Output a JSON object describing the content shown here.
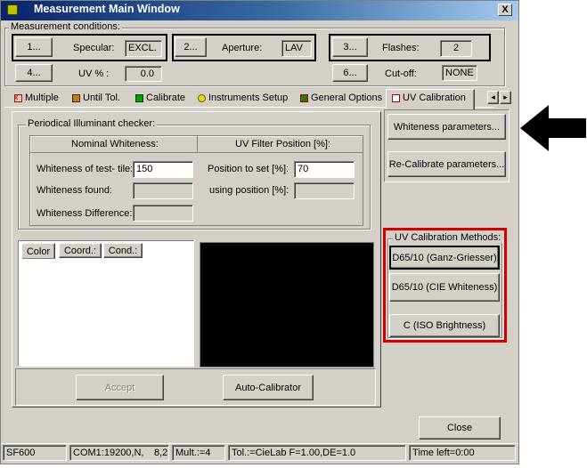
{
  "window": {
    "title": "Measurement Main Window",
    "close_glyph": "X"
  },
  "conditions": {
    "group_label": "Measurement conditions:",
    "btn1": "1...",
    "specular_label": "Specular:",
    "specular_value": "EXCL.",
    "btn2": "2...",
    "aperture_label": "Aperture:",
    "aperture_value": "LAV",
    "btn3": "3...",
    "flashes_label": "Flashes:",
    "flashes_value": "2",
    "btn4": "4...",
    "uv_label": "UV % :",
    "uv_value": "0.0",
    "btn6": "6...",
    "cutoff_label": "Cut-off:",
    "cutoff_value": "NONE"
  },
  "tabs": [
    {
      "label": "Multiple",
      "icon": "multiple-icon"
    },
    {
      "label": "Until Tol.",
      "icon": "until-tol-icon"
    },
    {
      "label": "Calibrate",
      "icon": "calibrate-icon"
    },
    {
      "label": "Instruments Setup",
      "icon": "instruments-setup-icon"
    },
    {
      "label": "General Options",
      "icon": "general-options-icon"
    },
    {
      "label": "UV Calibration",
      "icon": "uv-calibration-icon"
    }
  ],
  "tab_scroll": {
    "left": "◂",
    "right": "▸"
  },
  "checker": {
    "group_label": "Periodical Illuminant checker:",
    "col1_header": "Nominal Whiteness:",
    "col2_header": "UV Filter Position [%]:",
    "whiteness_test_label": "Whiteness of test- tile:",
    "whiteness_test_value": "150",
    "whiteness_found_label": "Whiteness found:",
    "whiteness_found_value": "",
    "whiteness_diff_label": "Whiteness Difference:",
    "whiteness_diff_value": "",
    "position_set_label": "Position to set [%]:",
    "position_set_value": "70",
    "using_position_label": "using position [%]:",
    "using_position_value": ""
  },
  "subtabs": [
    "Color",
    "Coord.:",
    "Cond.:"
  ],
  "buttons": {
    "whiteness_params": "Whiteness parameters...",
    "recalibrate_params": "Re-Calibrate parameters...",
    "accept": "Accept",
    "auto_calibrator": "Auto-Calibrator",
    "close": "Close"
  },
  "uv_methods": {
    "group_label": "UV Calibration Methods:",
    "d65_ganz": "D65/10 (Ganz-Griesser)",
    "d65_cie": "D65/10 (CIE Whiteness)",
    "c_iso": "C (ISO Brightness)"
  },
  "status_bar": [
    "SF600",
    "COM1:19200,N,",
    "8,2",
    "Mult.:=4",
    "Tol.:=CieLab F=1.00,DE=1.0",
    "Time left=0:00"
  ],
  "colors": {
    "highlight_red": "#d40000",
    "title_blue": "#0a246a",
    "face": "#d4d0c8"
  }
}
